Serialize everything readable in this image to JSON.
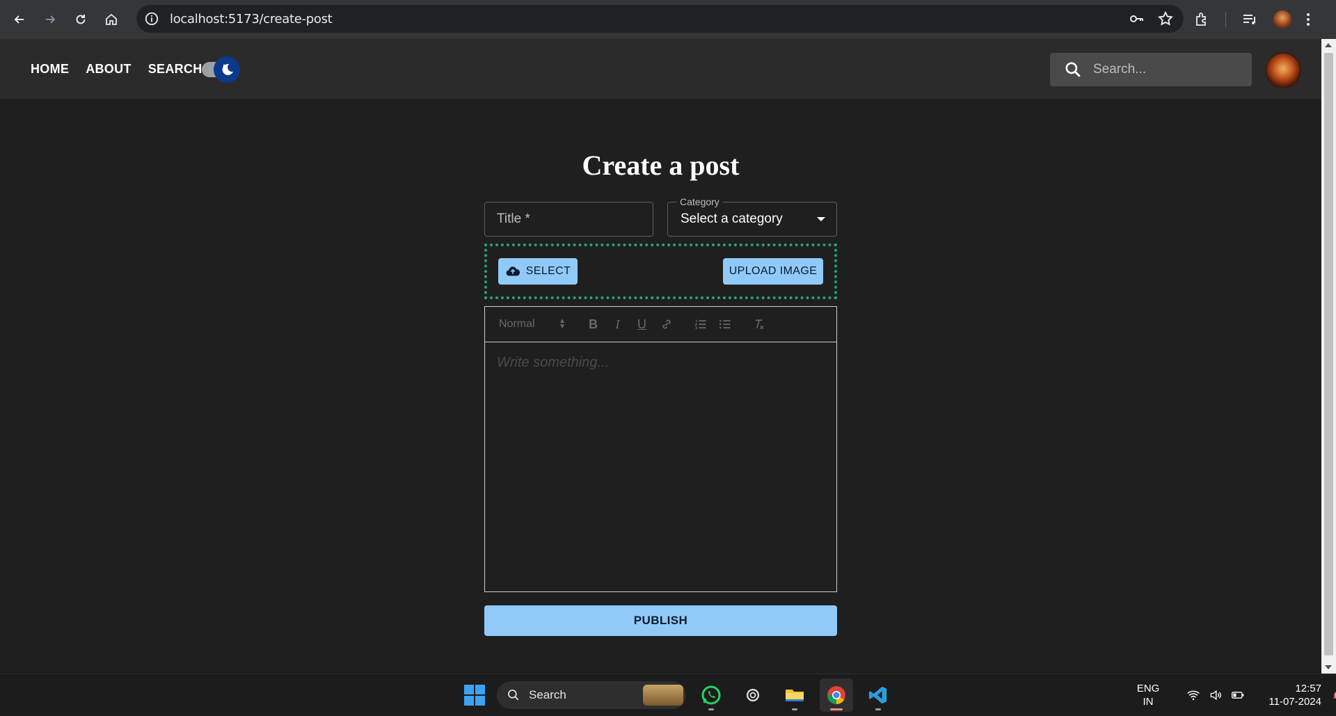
{
  "browser": {
    "url": "localhost:5173/create-post"
  },
  "header": {
    "nav": [
      "HOME",
      "ABOUT",
      "SEARCH"
    ],
    "search_placeholder": "Search..."
  },
  "page": {
    "title": "Create a post"
  },
  "form": {
    "title_placeholder": "Title *",
    "category_label": "Category",
    "category_value": "Select a category",
    "select_button": "SELECT",
    "upload_button": "UPLOAD IMAGE",
    "editor": {
      "heading_select": "Normal",
      "placeholder": "Write something..."
    },
    "publish_button": "PUBLISH"
  },
  "taskbar": {
    "search_label": "Search",
    "lang_line1": "ENG",
    "lang_line2": "IN",
    "time": "12:57",
    "date": "11-07-2024"
  },
  "colors": {
    "accent_button": "#90caf9",
    "upload_border": "#1faa6e",
    "toggle_thumb": "#0b3a8c",
    "background": "#1f1f1f"
  }
}
